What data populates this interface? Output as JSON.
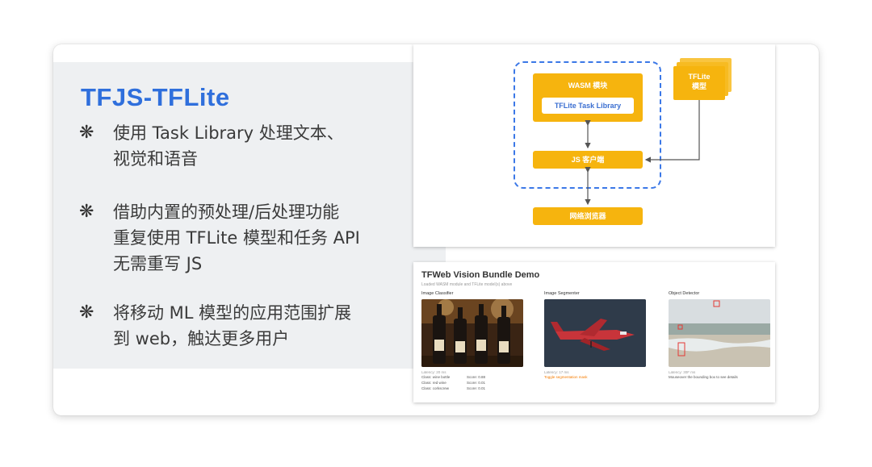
{
  "slide": {
    "title": "TFJS-TFLite",
    "bullets": [
      {
        "star": "❋",
        "lines": [
          "使用 Task Library 处理文本、",
          "视觉和语音"
        ]
      },
      {
        "star": "❋",
        "lines": [
          "借助内置的预处理/后处理功能",
          "重复使用 TFLite 模型和任务 API",
          "无需重写 JS"
        ]
      },
      {
        "star": "❋",
        "lines": [
          "将移动 ML 模型的应用范围扩展",
          "到 web，触达更多用户"
        ]
      }
    ]
  },
  "diagram": {
    "wasm_label": "WASM 模块",
    "task_library_label": "TFLite Task Library",
    "js_client_label": "JS 客户端",
    "browser_label": "网络浏览器",
    "model_label_line1": "TFLite",
    "model_label_line2": "模型",
    "colors": {
      "box": "#f6b40e",
      "dash": "#3b78e7",
      "arrow": "#555555"
    }
  },
  "demo": {
    "title": "TFWeb Vision Bundle Demo",
    "subtitle": "Loaded WASM module and TFLite model(s) above",
    "columns": [
      {
        "title": "Image Classifier",
        "latency": "Latency: 20 ms",
        "results": [
          {
            "cls": "Class: wine bottle",
            "score": "Score: 0.88"
          },
          {
            "cls": "Class: red wine",
            "score": "Score: 0.01"
          },
          {
            "cls": "Class: corkscrew",
            "score": "Score: 0.01"
          }
        ]
      },
      {
        "title": "Image Segmenter",
        "latency": "Latency: 17 ms",
        "link": "Toggle segmentation mask"
      },
      {
        "title": "Object Detector",
        "latency": "Latency: 30F ms",
        "note": "Mouseover the bounding box to see details"
      }
    ]
  }
}
